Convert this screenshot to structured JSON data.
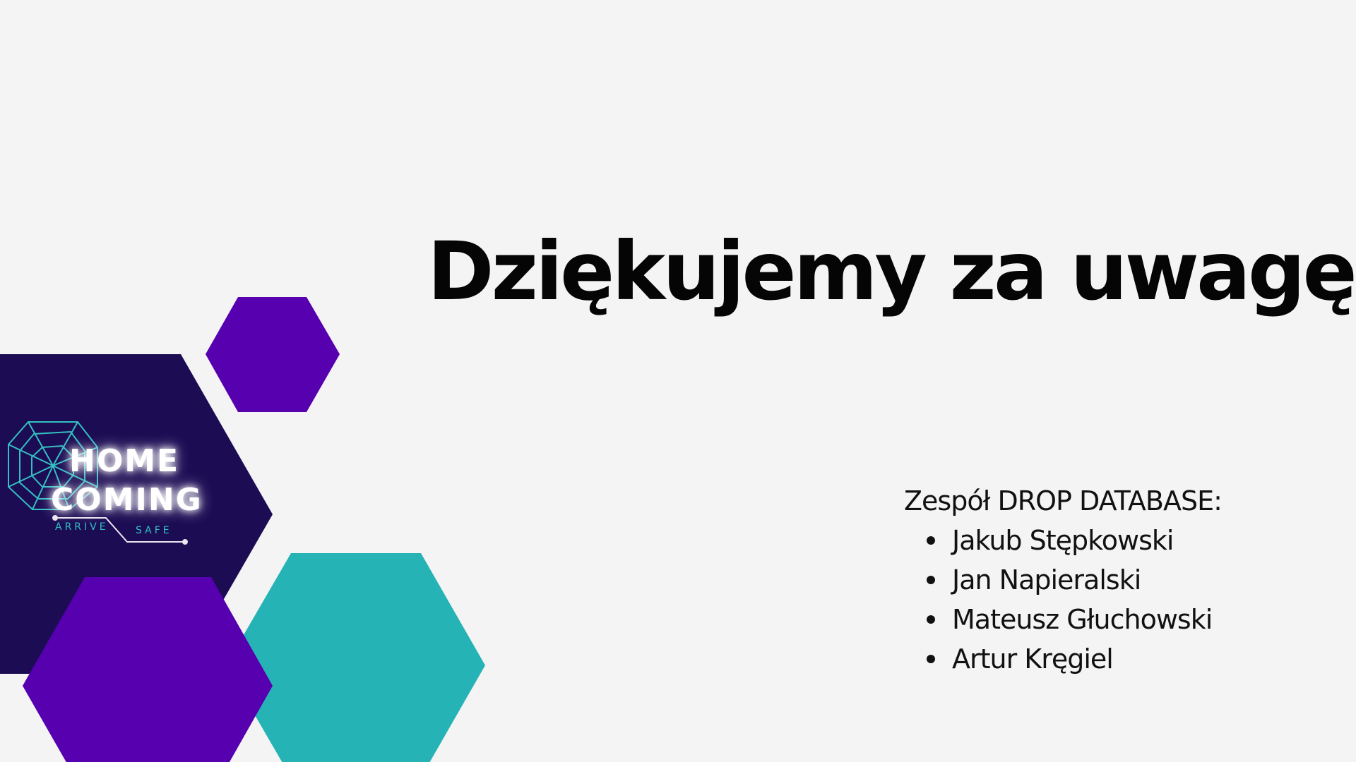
{
  "slide": {
    "title": "Dziękujemy za uwagę",
    "team": {
      "heading": "Zespół DROP DATABASE:",
      "members": [
        "Jakub Stępkowski",
        "Jan Napieralski",
        "Mateusz Głuchowski",
        "Artur Kręgiel"
      ]
    },
    "logo": {
      "line1": "HOME",
      "line2": "COMING",
      "tagline_left": "ARRIVE",
      "tagline_right": "SAFE"
    }
  },
  "colors": {
    "background": "#f4f4f5",
    "navy_hexagon": "#1c0c54",
    "purple_hexagon": "#5600b0",
    "teal_hexagon": "#25b3b5",
    "logo_teal": "#33c0c2",
    "text": "#050505"
  }
}
